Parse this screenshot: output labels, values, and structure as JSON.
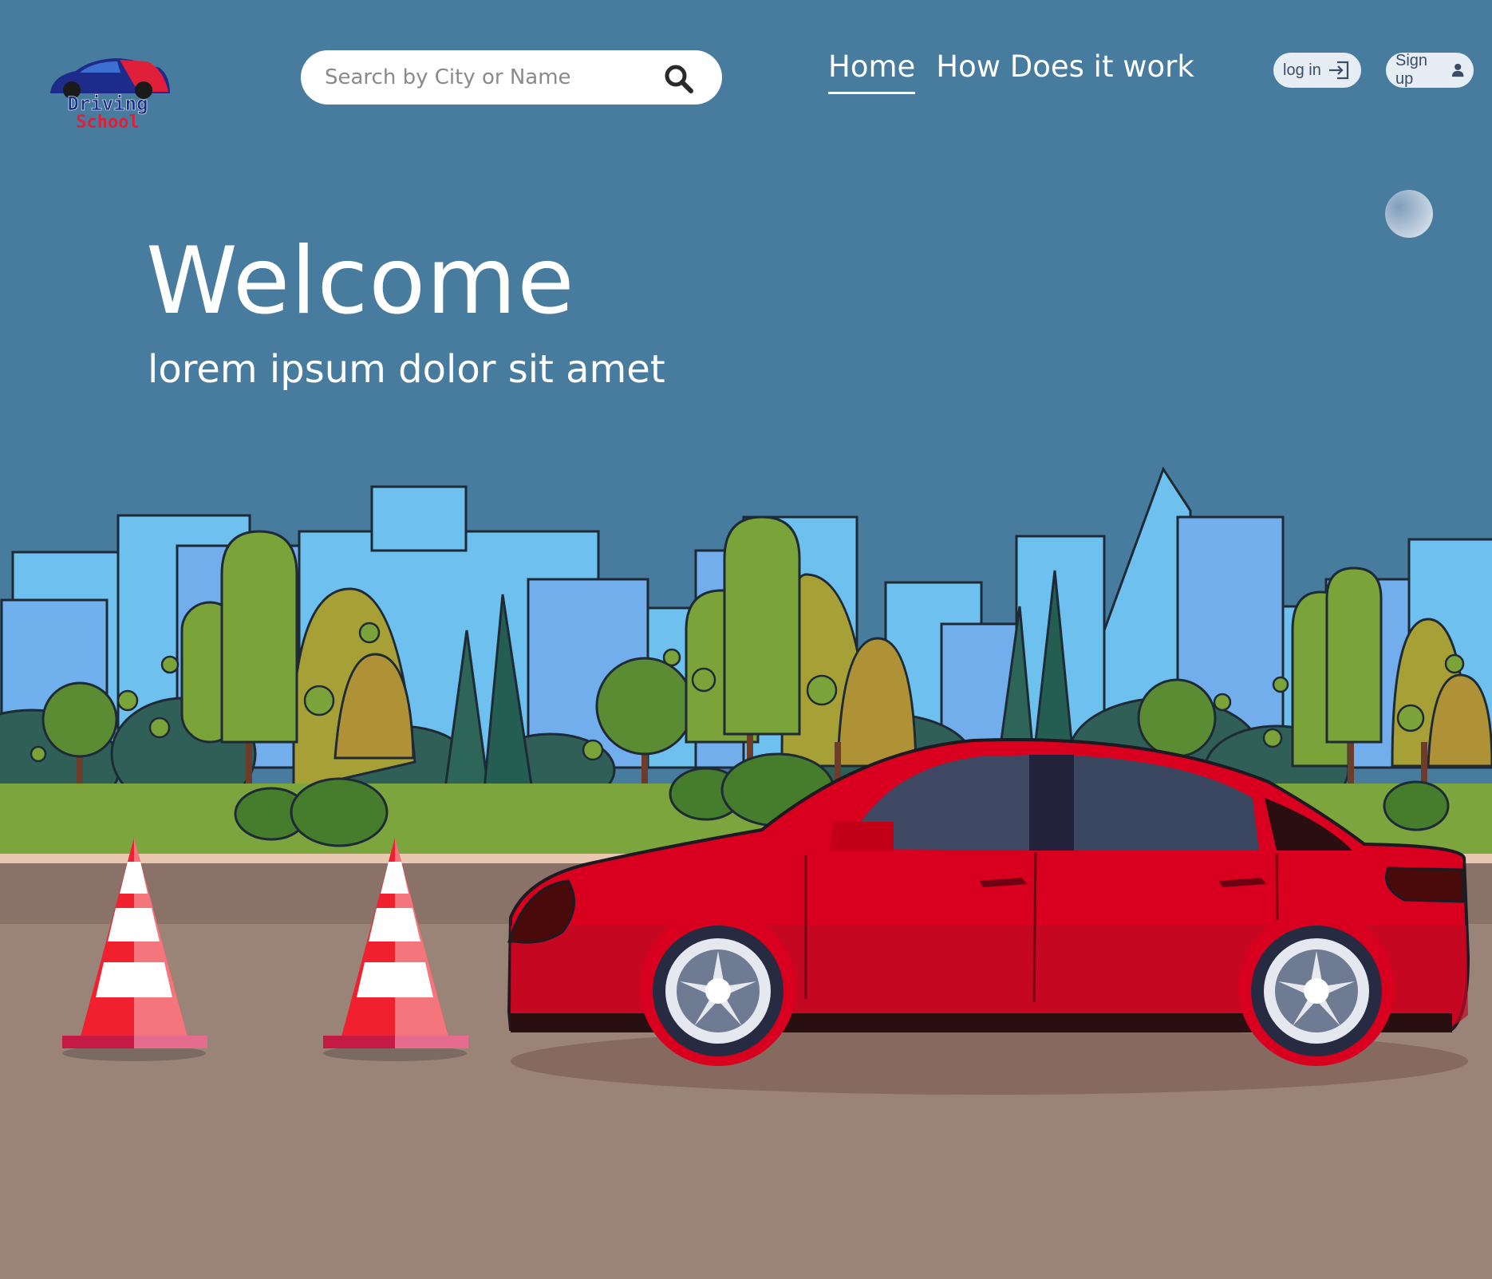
{
  "logo": {
    "text_line1": "Driving",
    "text_line2": "School",
    "icon": "car-logo-icon"
  },
  "search": {
    "placeholder": "Search by City or Name",
    "icon": "search-icon"
  },
  "nav": {
    "items": [
      {
        "label": "Home",
        "active": true
      },
      {
        "label": "How Does it work",
        "active": false
      }
    ]
  },
  "auth": {
    "login_label": "log in",
    "login_icon": "login-arrow-icon",
    "signup_label": "Sign up",
    "signup_icon": "user-icon"
  },
  "hero": {
    "title": "Welcome",
    "subtitle": "lorem ipsum dolor sit amet"
  },
  "colors": {
    "background": "#477c9f",
    "car": "#d8001e",
    "grass": "#7da53e",
    "road": "#9a8478"
  }
}
